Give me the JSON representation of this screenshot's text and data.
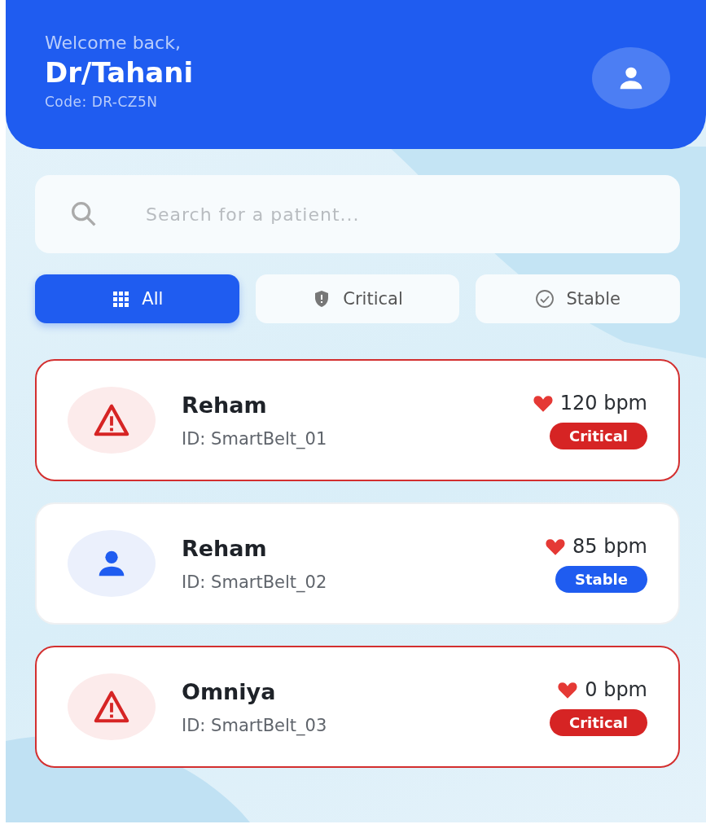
{
  "header": {
    "greeting": "Welcome back,",
    "name": "Dr/Tahani",
    "code": "Code: DR-CZ5N"
  },
  "search": {
    "placeholder": "Search for a patient..."
  },
  "filters": [
    {
      "label": "All",
      "kind": "grid",
      "selected": true
    },
    {
      "label": "Critical",
      "kind": "shield",
      "selected": false
    },
    {
      "label": "Stable",
      "kind": "check",
      "selected": false
    }
  ],
  "patients": [
    {
      "name": "Reham",
      "id": "ID: SmartBelt_01",
      "heart_rate": "120 bpm",
      "status": "Critical",
      "kind": "critical"
    },
    {
      "name": "Reham",
      "id": "ID: SmartBelt_02",
      "heart_rate": "85 bpm",
      "status": "Stable",
      "kind": "stable"
    },
    {
      "name": "Omniya",
      "id": "ID: SmartBelt_03",
      "heart_rate": "0 bpm",
      "status": "Critical",
      "kind": "critical"
    }
  ]
}
